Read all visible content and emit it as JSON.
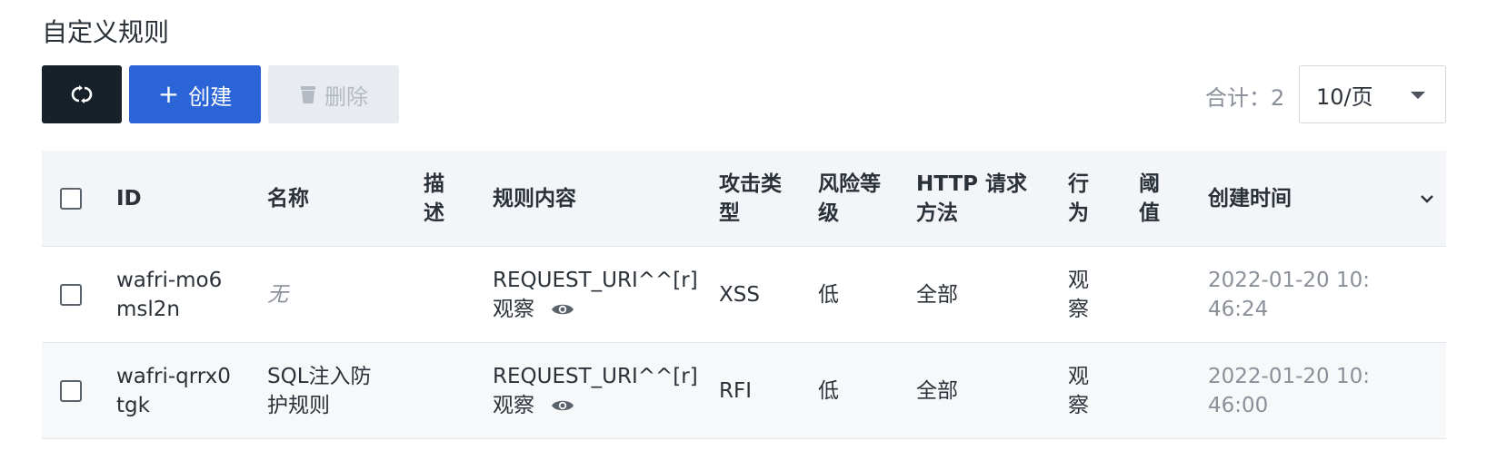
{
  "page": {
    "title": "自定义规则"
  },
  "toolbar": {
    "refresh_icon": "refresh-icon",
    "create_label": "创建",
    "create_plus": "+",
    "delete_label": "删除",
    "total_label": "合计：2",
    "page_size_value": "10/页"
  },
  "table": {
    "headers": {
      "id": "ID",
      "name": "名称",
      "desc_line1": "描",
      "desc_line2": "述",
      "content": "规则内容",
      "attack_line1": "攻击类",
      "attack_line2": "型",
      "risk_line1": "风险等",
      "risk_line2": "级",
      "method_line1": "HTTP 请求",
      "method_line2": "方法",
      "action_line1": "行",
      "action_line2": "为",
      "threshold_line1": "阈",
      "threshold_line2": "值",
      "created": "创建时间"
    },
    "rows": [
      {
        "id_line1": "wafri-mo6",
        "id_line2": "msl2n",
        "name_line1": "无",
        "name_line2": "",
        "content_line1": "REQUEST_URI^^[r]",
        "content_line2": "观察",
        "attack": "XSS",
        "risk": "低",
        "method": "全部",
        "action_line1": "观",
        "action_line2": "察",
        "created_line1": "2022-01-20 10:",
        "created_line2": "46:24"
      },
      {
        "id_line1": "wafri-qrrx0",
        "id_line2": "tgk",
        "name_line1": "SQL注入防",
        "name_line2": "护规则",
        "content_line1": "REQUEST_URI^^[r]",
        "content_line2": "观察",
        "attack": "RFI",
        "risk": "低",
        "method": "全部",
        "action_line1": "观",
        "action_line2": "察",
        "created_line1": "2022-01-20 10:",
        "created_line2": "46:00"
      }
    ]
  }
}
